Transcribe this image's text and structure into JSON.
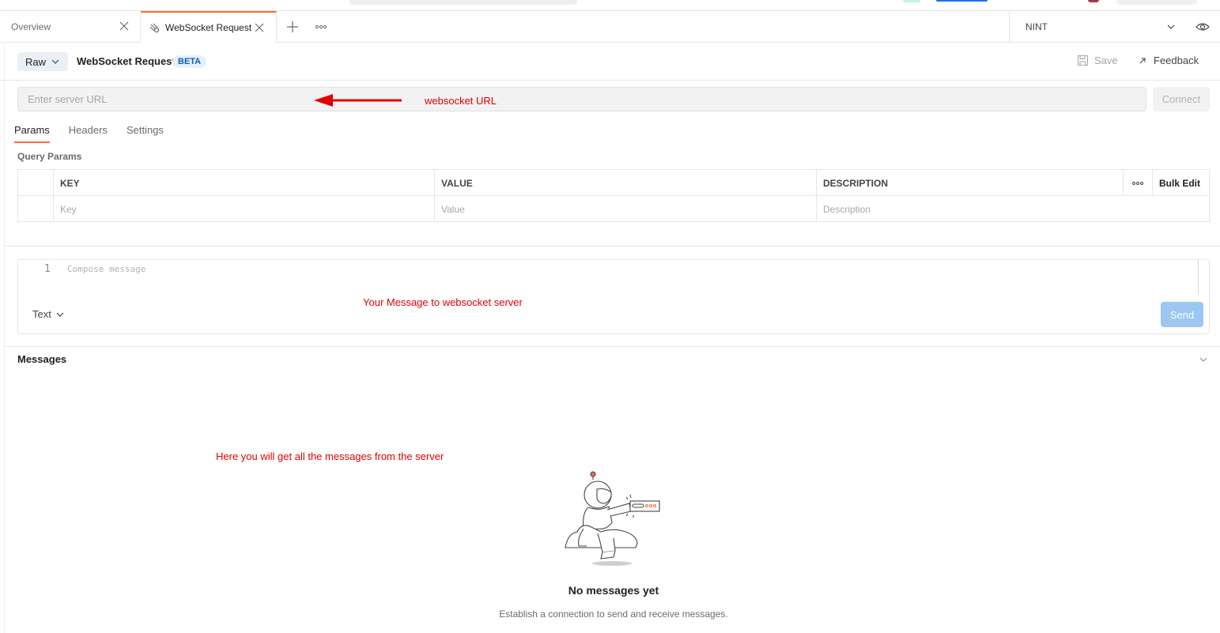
{
  "tabs": [
    {
      "label": "Overview",
      "active": false
    },
    {
      "label": "WebSocket Request",
      "active": true
    }
  ],
  "environment": {
    "label": "NINT"
  },
  "request": {
    "mode": "Raw",
    "title": "WebSocket Request",
    "badge": "BETA",
    "save_label": "Save",
    "feedback_label": "Feedback"
  },
  "url": {
    "placeholder": "Enter server URL",
    "value": "",
    "connect_label": "Connect"
  },
  "annotations": {
    "url_note": "websocket URL",
    "message_note": "Your Message to websocket server",
    "messages_note": "Here you will get all the messages from the server"
  },
  "subtabs": [
    {
      "label": "Params",
      "active": true
    },
    {
      "label": "Headers",
      "active": false
    },
    {
      "label": "Settings",
      "active": false
    }
  ],
  "query_params": {
    "title": "Query Params",
    "columns": [
      "KEY",
      "VALUE",
      "DESCRIPTION"
    ],
    "bulk_edit": "Bulk Edit",
    "row_placeholders": [
      "Key",
      "Value",
      "Description"
    ]
  },
  "composer": {
    "line_number": "1",
    "placeholder": "Compose message",
    "format": "Text",
    "send_label": "Send"
  },
  "messages": {
    "title": "Messages",
    "empty_title": "No messages yet",
    "empty_subtitle": "Establish a connection to send and receive messages."
  },
  "colors": {
    "accent": "#ff6c37",
    "annotation": "#e00000",
    "send_disabled": "#9cc7f2",
    "badge_text": "#0b5fb8"
  }
}
